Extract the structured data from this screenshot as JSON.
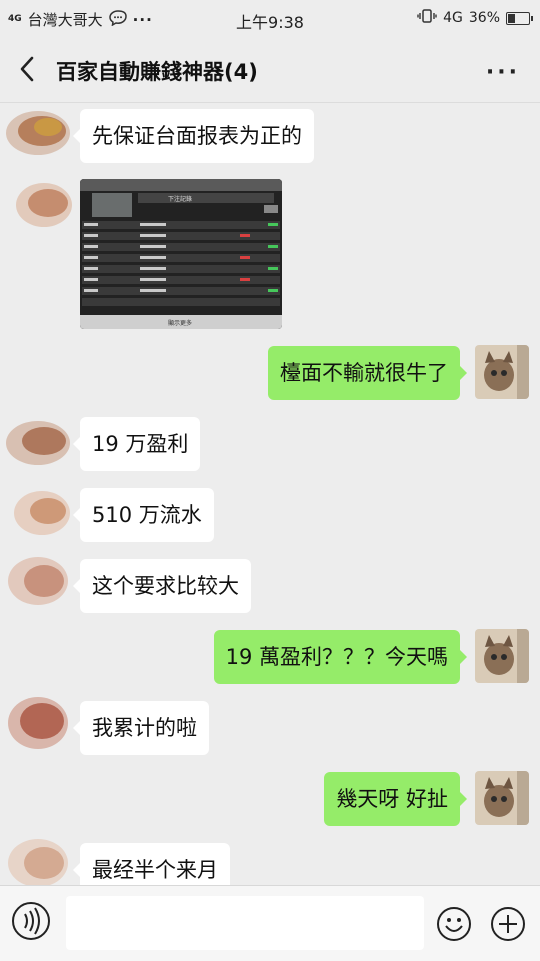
{
  "statusbar": {
    "network_small": "4G",
    "carrier": "台灣大哥大",
    "time": "上午9:38",
    "network": "4G",
    "battery": "36%",
    "battery_level": 0.36
  },
  "header": {
    "title": "百家自動賺錢神器(4)"
  },
  "messages": [
    {
      "side": "left",
      "text": "先保证台面报表为正的"
    },
    {
      "side": "left",
      "type": "image",
      "image_header": "下注記錄",
      "image_footer": "顯示更多"
    },
    {
      "side": "right",
      "text": "檯面不輸就很牛了"
    },
    {
      "side": "left",
      "text": "19 万盈利"
    },
    {
      "side": "left",
      "text": "510 万流水"
    },
    {
      "side": "left",
      "text": "这个要求比较大"
    },
    {
      "side": "right",
      "text": "19 萬盈利？？？今天嗎"
    },
    {
      "side": "left",
      "text": "我累计的啦"
    },
    {
      "side": "right",
      "text": "幾天呀 好扯"
    },
    {
      "side": "left",
      "text": "最经半个来月"
    }
  ],
  "colors": {
    "background": "#ededed",
    "bubble_left": "#ffffff",
    "bubble_right": "#95ec69"
  },
  "icons": [
    "back-arrow-icon",
    "more-icon",
    "voice-icon",
    "emoji-icon",
    "plus-icon"
  ]
}
